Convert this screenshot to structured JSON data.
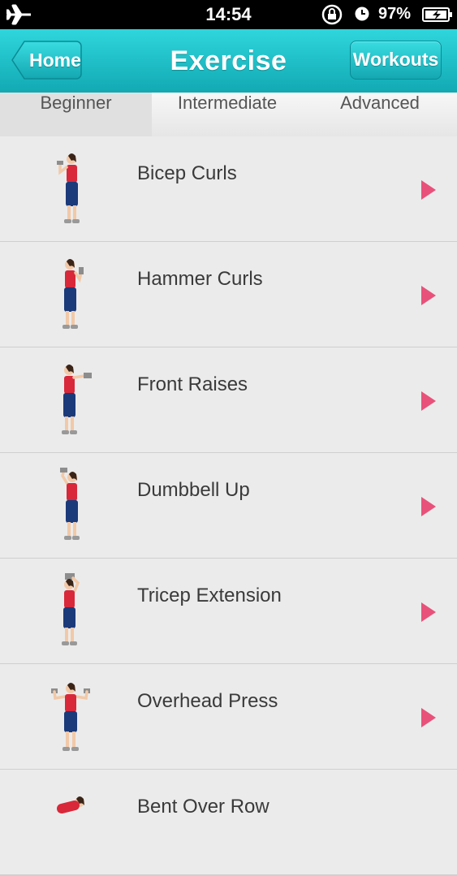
{
  "status": {
    "time": "14:54",
    "battery_pct": "97%"
  },
  "nav": {
    "title": "Exercise",
    "home_label": "Home",
    "workouts_label": "Workouts"
  },
  "tabs": [
    {
      "label": "Beginner",
      "active": true
    },
    {
      "label": "Intermediate",
      "active": false
    },
    {
      "label": "Advanced",
      "active": false
    }
  ],
  "exercises": [
    {
      "label": "Bicep Curls"
    },
    {
      "label": "Hammer Curls"
    },
    {
      "label": "Front Raises"
    },
    {
      "label": "Dumbbell Up"
    },
    {
      "label": "Tricep Extension"
    },
    {
      "label": "Overhead Press"
    },
    {
      "label": "Bent Over Row"
    }
  ],
  "colors": {
    "nav": "#1fbfc8",
    "arrow": "#e8527a",
    "shirt": "#d8283a",
    "pants": "#1b3a7a"
  },
  "icons": [
    "airplane-icon",
    "rotation-lock-icon",
    "alarm-icon",
    "battery-icon",
    "chevron-right-icon"
  ]
}
